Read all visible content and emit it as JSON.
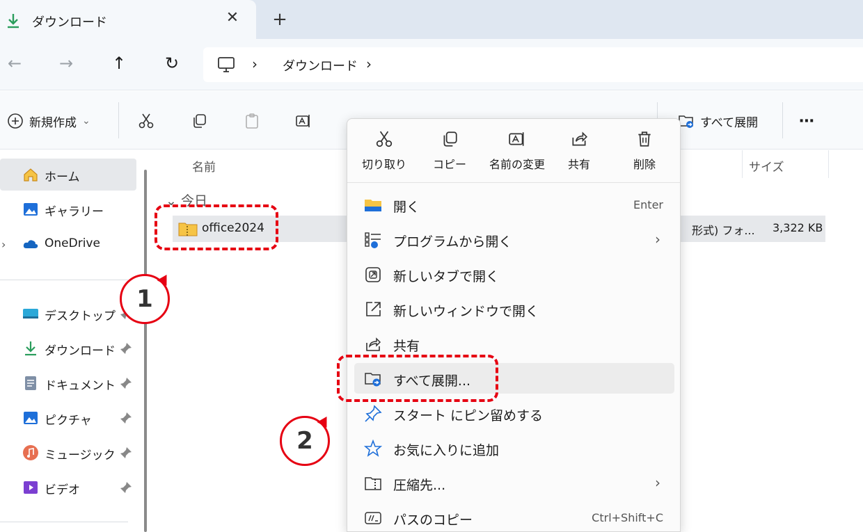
{
  "tab": {
    "label": "ダウンロード",
    "close": "✕",
    "new": "+"
  },
  "nav": {
    "back": "←",
    "forward": "→",
    "up": "↑",
    "refresh": "↻"
  },
  "address": {
    "sep": "›",
    "crumb": "ダウンロード"
  },
  "toolbar": {
    "new_label": "新規作成",
    "new_chevron": "⌄",
    "extract_all": "すべて展開",
    "more": "⋯"
  },
  "sidebar": {
    "items": [
      {
        "label": "ホーム"
      },
      {
        "label": "ギャラリー"
      },
      {
        "label": "OneDrive"
      },
      {
        "label": "デスクトップ"
      },
      {
        "label": "ダウンロード"
      },
      {
        "label": "ドキュメント"
      },
      {
        "label": "ピクチャ"
      },
      {
        "label": "ミュージック"
      },
      {
        "label": "ビデオ"
      }
    ],
    "expand": "›"
  },
  "content": {
    "col_name": "名前",
    "col_size": "サイズ",
    "group": "今日",
    "group_chevron": "⌄",
    "file": {
      "name": "office2024",
      "type": "形式) フォ...",
      "size": "3,322 KB"
    }
  },
  "context_menu": {
    "quick_actions": [
      {
        "label": "切り取り"
      },
      {
        "label": "コピー"
      },
      {
        "label": "名前の変更"
      },
      {
        "label": "共有"
      },
      {
        "label": "削除"
      }
    ],
    "items": [
      {
        "label": "開く",
        "shortcut": "Enter"
      },
      {
        "label": "プログラムから開く",
        "arrow": "›"
      },
      {
        "label": "新しいタブで開く"
      },
      {
        "label": "新しいウィンドウで開く"
      },
      {
        "label": "共有"
      },
      {
        "label": "すべて展開..."
      },
      {
        "label": "スタート にピン留めする"
      },
      {
        "label": "お気に入りに追加"
      },
      {
        "label": "圧縮先...",
        "arrow": "›"
      },
      {
        "label": "パスのコピー",
        "shortcut": "Ctrl+Shift+C"
      }
    ]
  },
  "annotations": {
    "step1": "1",
    "step2": "2"
  },
  "colors": {
    "accent": "#e60012",
    "folder": "#f6c445",
    "blue": "#1e6fd9"
  }
}
